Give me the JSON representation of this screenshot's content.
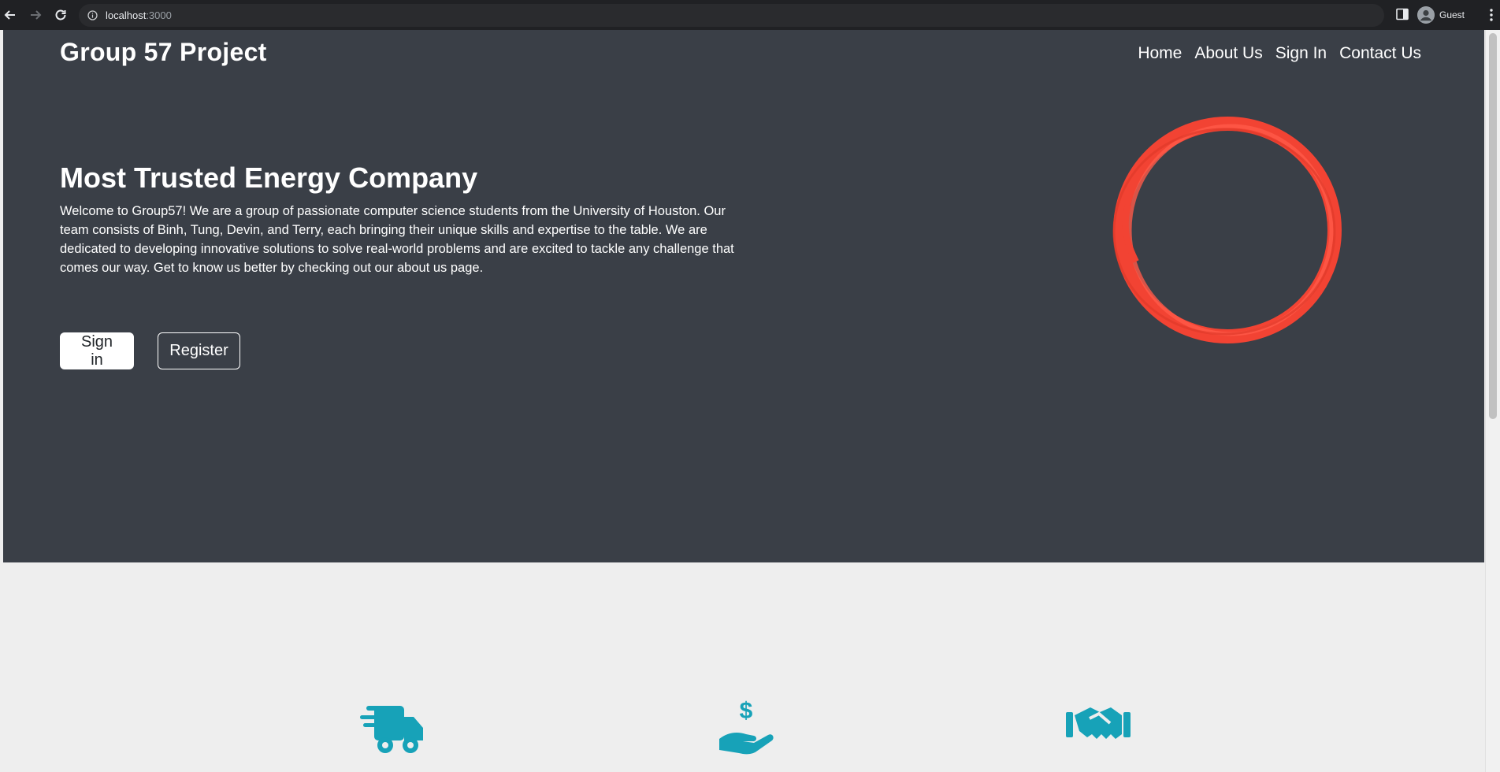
{
  "browser": {
    "url_host": "localhost",
    "url_port": ":3000",
    "profile_label": "Guest"
  },
  "site": {
    "brand": "Group 57 Project",
    "nav": [
      {
        "label": "Home"
      },
      {
        "label": "About Us"
      },
      {
        "label": "Sign In"
      },
      {
        "label": "Contact Us"
      }
    ]
  },
  "hero": {
    "title": "Most Trusted Energy Company",
    "body": "Welcome to Group57! We are a group of passionate computer science students from the University of Houston. Our team consists of Binh, Tung, Devin, and Terry, each bringing their unique skills and expertise to the table. We are dedicated to developing innovative solutions to solve real-world problems and are excited to tackle any challenge that comes our way. Get to know us better by checking out our about us page.",
    "signin_label": "Sign in",
    "register_label": "Register"
  },
  "features": {
    "icons": [
      "truck-icon",
      "hand-dollar-icon",
      "handshake-icon"
    ]
  },
  "colors": {
    "hero_bg": "#3a3f47",
    "accent": "#17a2b8",
    "ring": "#f24333",
    "section_bg": "#eeeeee"
  }
}
